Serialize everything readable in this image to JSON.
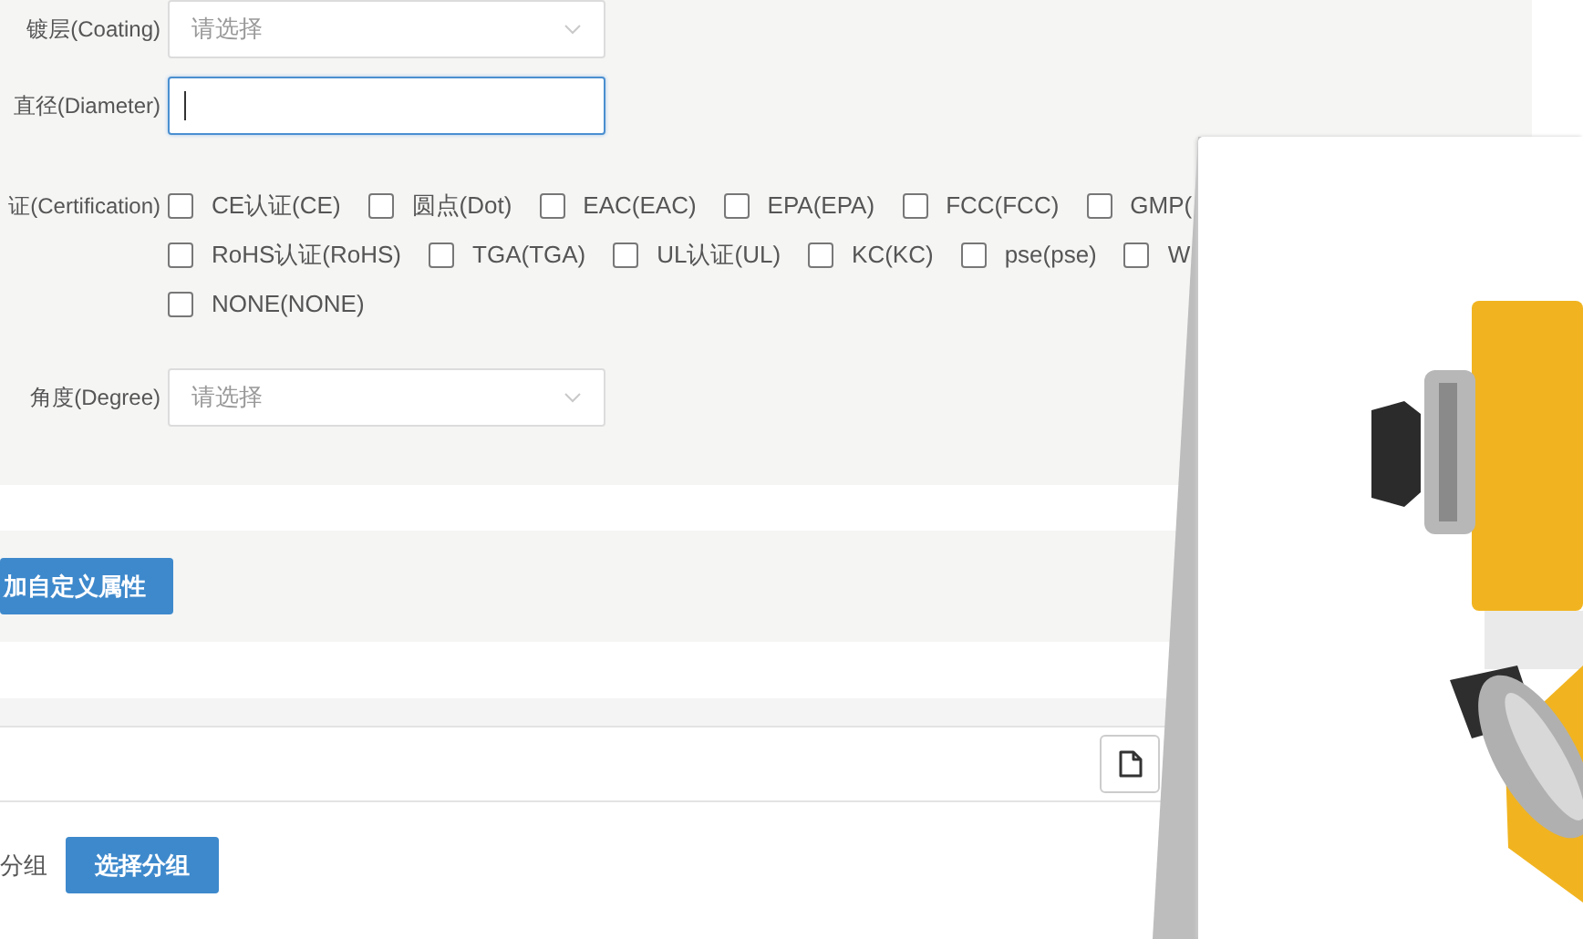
{
  "form": {
    "fields": [
      {
        "kind": "select",
        "label": "镀层(Coating)",
        "placeholder": "请选择"
      },
      {
        "kind": "text",
        "label": "直径(Diameter)",
        "focused": true
      },
      {
        "kind": "checkboxes",
        "label": "证(Certification)",
        "option_rows": [
          [
            {
              "label": "CE认证(CE)",
              "checked": false
            },
            {
              "label": "圆点(Dot)",
              "checked": false
            },
            {
              "label": "EAC(EAC)",
              "checked": false
            },
            {
              "label": "EPA(EPA)",
              "checked": false
            },
            {
              "label": "FCC(FCC)",
              "checked": false
            },
            {
              "label": "GMP(",
              "checked": false
            }
          ],
          [
            {
              "label": "RoHS认证(RoHS)",
              "checked": false
            },
            {
              "label": "TGA(TGA)",
              "checked": false
            },
            {
              "label": "UL认证(UL)",
              "checked": false
            },
            {
              "label": "KC(KC)",
              "checked": false
            },
            {
              "label": "pse(pse)",
              "checked": false
            },
            {
              "label": "W",
              "checked": false
            }
          ],
          [
            {
              "label": "NONE(NONE)",
              "checked": false
            }
          ]
        ]
      },
      {
        "kind": "select",
        "label": "角度(Degree)",
        "placeholder": "请选择"
      }
    ]
  },
  "add_attribute_button": "加自定义属性",
  "group": {
    "label": "分组",
    "button": "选择分组"
  }
}
